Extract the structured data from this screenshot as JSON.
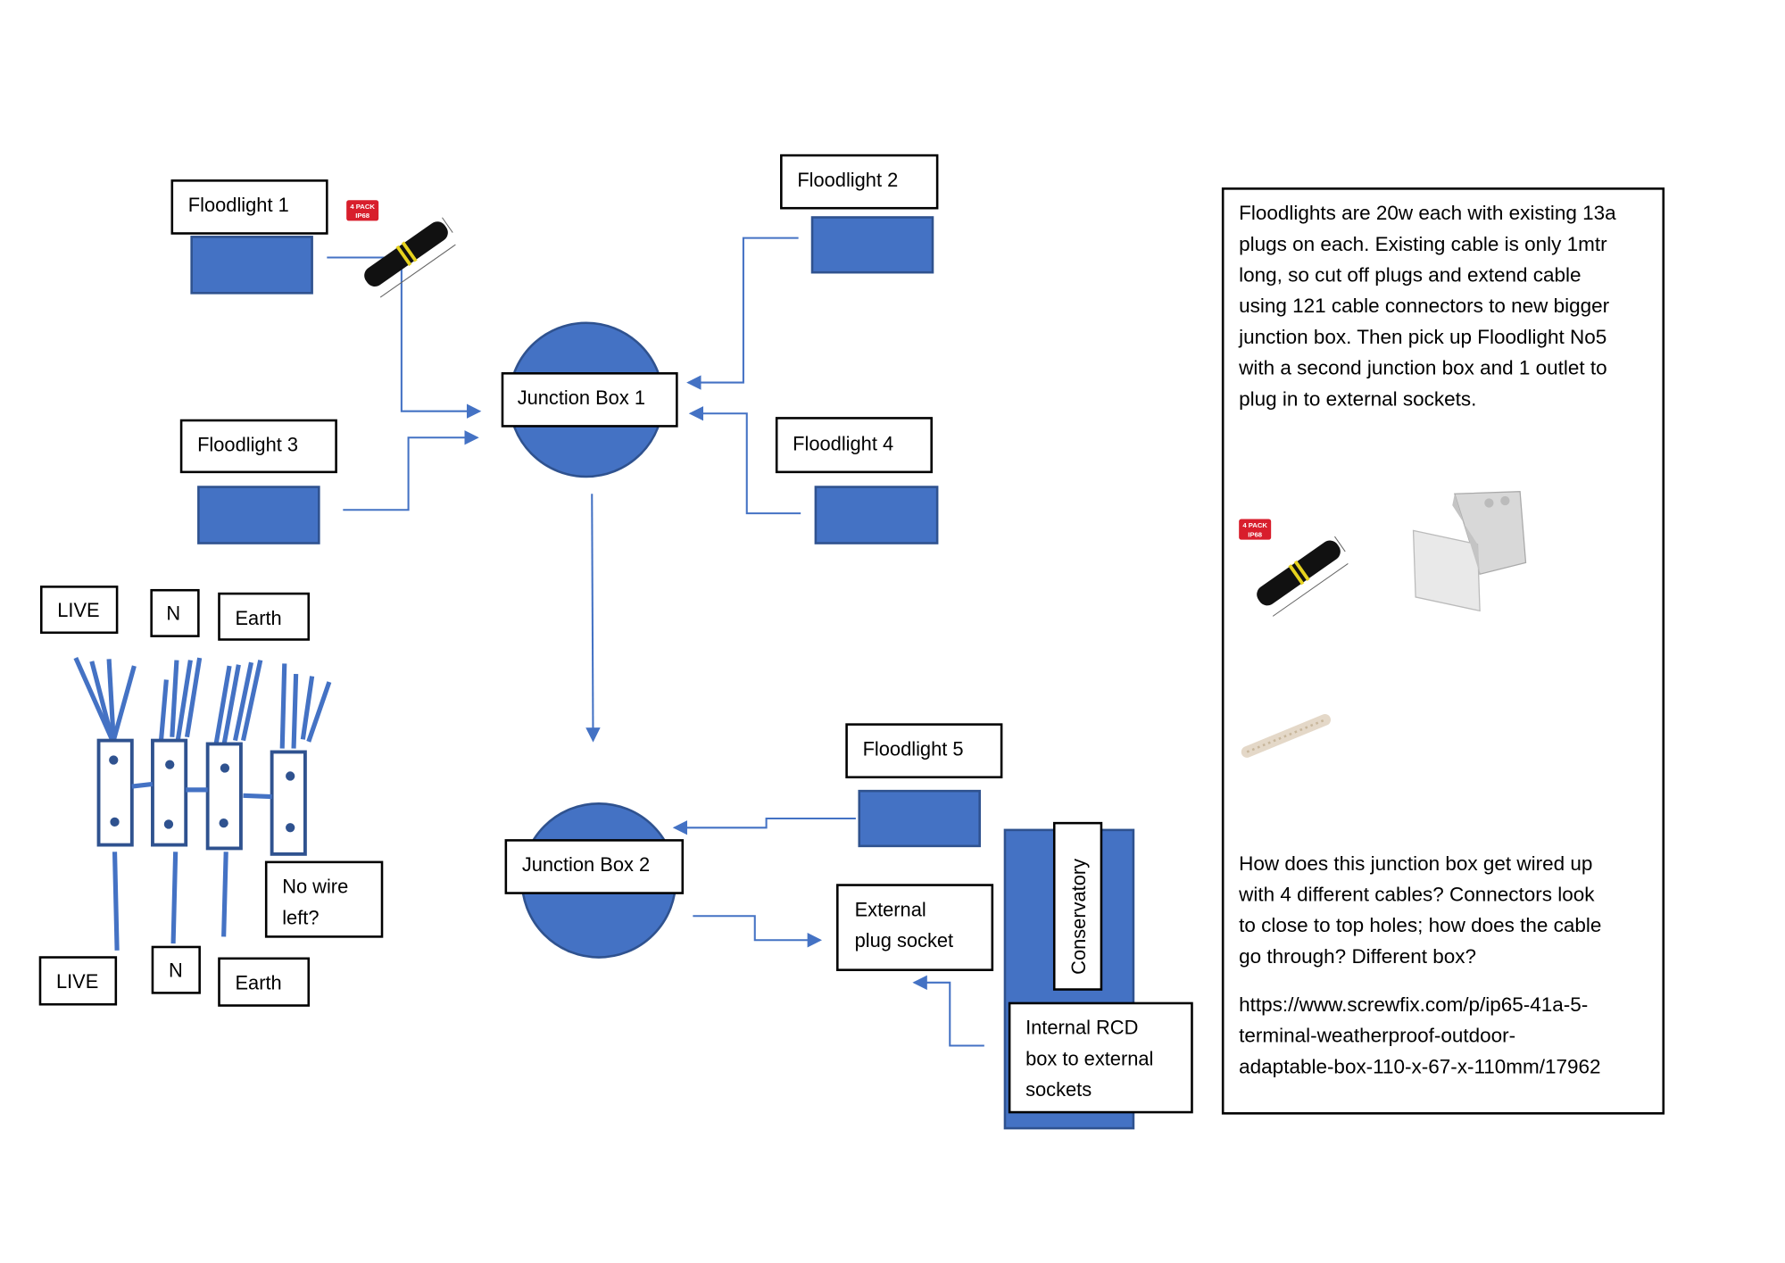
{
  "colors": {
    "shape_fill": "#4472C4",
    "shape_stroke": "#2F528F",
    "connector": "#4472C4"
  },
  "floodlights": [
    "Floodlight 1",
    "Floodlight 2",
    "Floodlight 3",
    "Floodlight 4",
    "Floodlight 5"
  ],
  "junction_boxes": [
    "Junction Box 1",
    "Junction Box 2"
  ],
  "external_socket": [
    "External",
    "plug socket"
  ],
  "conservatory": "Conservatory",
  "rcd": [
    "Internal RCD",
    "box to external",
    "sockets"
  ],
  "wiring": {
    "top_labels": [
      "LIVE",
      "N",
      "Earth"
    ],
    "bottom_labels": [
      "LIVE",
      "N",
      "Earth"
    ],
    "question": [
      "No wire",
      "left?"
    ]
  },
  "connector_badge": {
    "pack": "4 PACK",
    "rating": "IP68"
  },
  "notes": {
    "intro": [
      "Floodlights are 20w each with existing 13a",
      "plugs on each. Existing cable is only 1mtr",
      "long, so cut off plugs and extend cable",
      "using 121 cable connectors to new bigger",
      "junction box. Then pick up Floodlight No5",
      "with a second junction box and 1 outlet to",
      "plug in to external sockets."
    ],
    "question": [
      "How does this junction box get wired up",
      "with 4 different cables? Connectors look",
      "to close to top holes; how does the cable",
      "go through? Different box?"
    ],
    "link": [
      "https://www.screwfix.com/p/ip65-41a-5-",
      "terminal-weatherproof-outdoor-",
      "adaptable-box-110-x-67-x-110mm/17962"
    ]
  }
}
